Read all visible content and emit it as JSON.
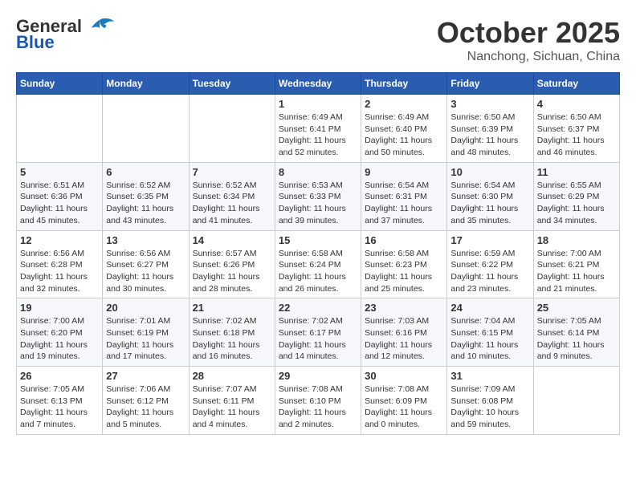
{
  "header": {
    "logo_general": "General",
    "logo_blue": "Blue",
    "month": "October 2025",
    "location": "Nanchong, Sichuan, China"
  },
  "weekdays": [
    "Sunday",
    "Monday",
    "Tuesday",
    "Wednesday",
    "Thursday",
    "Friday",
    "Saturday"
  ],
  "weeks": [
    [
      {
        "day": "",
        "info": ""
      },
      {
        "day": "",
        "info": ""
      },
      {
        "day": "",
        "info": ""
      },
      {
        "day": "1",
        "info": "Sunrise: 6:49 AM\nSunset: 6:41 PM\nDaylight: 11 hours\nand 52 minutes."
      },
      {
        "day": "2",
        "info": "Sunrise: 6:49 AM\nSunset: 6:40 PM\nDaylight: 11 hours\nand 50 minutes."
      },
      {
        "day": "3",
        "info": "Sunrise: 6:50 AM\nSunset: 6:39 PM\nDaylight: 11 hours\nand 48 minutes."
      },
      {
        "day": "4",
        "info": "Sunrise: 6:50 AM\nSunset: 6:37 PM\nDaylight: 11 hours\nand 46 minutes."
      }
    ],
    [
      {
        "day": "5",
        "info": "Sunrise: 6:51 AM\nSunset: 6:36 PM\nDaylight: 11 hours\nand 45 minutes."
      },
      {
        "day": "6",
        "info": "Sunrise: 6:52 AM\nSunset: 6:35 PM\nDaylight: 11 hours\nand 43 minutes."
      },
      {
        "day": "7",
        "info": "Sunrise: 6:52 AM\nSunset: 6:34 PM\nDaylight: 11 hours\nand 41 minutes."
      },
      {
        "day": "8",
        "info": "Sunrise: 6:53 AM\nSunset: 6:33 PM\nDaylight: 11 hours\nand 39 minutes."
      },
      {
        "day": "9",
        "info": "Sunrise: 6:54 AM\nSunset: 6:31 PM\nDaylight: 11 hours\nand 37 minutes."
      },
      {
        "day": "10",
        "info": "Sunrise: 6:54 AM\nSunset: 6:30 PM\nDaylight: 11 hours\nand 35 minutes."
      },
      {
        "day": "11",
        "info": "Sunrise: 6:55 AM\nSunset: 6:29 PM\nDaylight: 11 hours\nand 34 minutes."
      }
    ],
    [
      {
        "day": "12",
        "info": "Sunrise: 6:56 AM\nSunset: 6:28 PM\nDaylight: 11 hours\nand 32 minutes."
      },
      {
        "day": "13",
        "info": "Sunrise: 6:56 AM\nSunset: 6:27 PM\nDaylight: 11 hours\nand 30 minutes."
      },
      {
        "day": "14",
        "info": "Sunrise: 6:57 AM\nSunset: 6:26 PM\nDaylight: 11 hours\nand 28 minutes."
      },
      {
        "day": "15",
        "info": "Sunrise: 6:58 AM\nSunset: 6:24 PM\nDaylight: 11 hours\nand 26 minutes."
      },
      {
        "day": "16",
        "info": "Sunrise: 6:58 AM\nSunset: 6:23 PM\nDaylight: 11 hours\nand 25 minutes."
      },
      {
        "day": "17",
        "info": "Sunrise: 6:59 AM\nSunset: 6:22 PM\nDaylight: 11 hours\nand 23 minutes."
      },
      {
        "day": "18",
        "info": "Sunrise: 7:00 AM\nSunset: 6:21 PM\nDaylight: 11 hours\nand 21 minutes."
      }
    ],
    [
      {
        "day": "19",
        "info": "Sunrise: 7:00 AM\nSunset: 6:20 PM\nDaylight: 11 hours\nand 19 minutes."
      },
      {
        "day": "20",
        "info": "Sunrise: 7:01 AM\nSunset: 6:19 PM\nDaylight: 11 hours\nand 17 minutes."
      },
      {
        "day": "21",
        "info": "Sunrise: 7:02 AM\nSunset: 6:18 PM\nDaylight: 11 hours\nand 16 minutes."
      },
      {
        "day": "22",
        "info": "Sunrise: 7:02 AM\nSunset: 6:17 PM\nDaylight: 11 hours\nand 14 minutes."
      },
      {
        "day": "23",
        "info": "Sunrise: 7:03 AM\nSunset: 6:16 PM\nDaylight: 11 hours\nand 12 minutes."
      },
      {
        "day": "24",
        "info": "Sunrise: 7:04 AM\nSunset: 6:15 PM\nDaylight: 11 hours\nand 10 minutes."
      },
      {
        "day": "25",
        "info": "Sunrise: 7:05 AM\nSunset: 6:14 PM\nDaylight: 11 hours\nand 9 minutes."
      }
    ],
    [
      {
        "day": "26",
        "info": "Sunrise: 7:05 AM\nSunset: 6:13 PM\nDaylight: 11 hours\nand 7 minutes."
      },
      {
        "day": "27",
        "info": "Sunrise: 7:06 AM\nSunset: 6:12 PM\nDaylight: 11 hours\nand 5 minutes."
      },
      {
        "day": "28",
        "info": "Sunrise: 7:07 AM\nSunset: 6:11 PM\nDaylight: 11 hours\nand 4 minutes."
      },
      {
        "day": "29",
        "info": "Sunrise: 7:08 AM\nSunset: 6:10 PM\nDaylight: 11 hours\nand 2 minutes."
      },
      {
        "day": "30",
        "info": "Sunrise: 7:08 AM\nSunset: 6:09 PM\nDaylight: 11 hours\nand 0 minutes."
      },
      {
        "day": "31",
        "info": "Sunrise: 7:09 AM\nSunset: 6:08 PM\nDaylight: 10 hours\nand 59 minutes."
      },
      {
        "day": "",
        "info": ""
      }
    ]
  ]
}
